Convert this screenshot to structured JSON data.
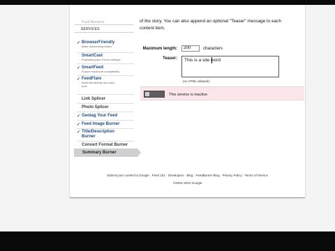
{
  "intro": {
    "line1": "of the story. You can also append an optional \"Teaser\" message to each",
    "line2": "content item."
  },
  "sidebar": {
    "faded_heading": "Feed Burners",
    "services_heading": "SERVICES",
    "items": [
      {
        "checked": true,
        "name": "BrowserFriendly",
        "desc": "Make subscribing easier"
      },
      {
        "checked": false,
        "name": "SmartCast",
        "desc": "Podcasting and iTunes settings"
      },
      {
        "checked": true,
        "name": "SmartFeed",
        "desc": "Ensure maximum compatibility"
      },
      {
        "checked": true,
        "name": "FeedFlare",
        "desc1": "Build interactivity into each",
        "desc2": "post"
      },
      {
        "checked": false,
        "name": "Link Splicer"
      },
      {
        "checked": false,
        "name": "Photo Splicer"
      },
      {
        "checked": true,
        "name": "Geotag Your Feed"
      },
      {
        "checked": true,
        "name": "Feed Image Burner"
      },
      {
        "checked": true,
        "name": "Title/Description",
        "name2": "Burner"
      },
      {
        "checked": false,
        "name": "Convert Format Burner"
      },
      {
        "checked": false,
        "name": "Summary Burner",
        "selected": true
      }
    ]
  },
  "form": {
    "max_length_label": "Maximum length:",
    "max_length_value": "200",
    "max_length_unit": "characters",
    "teaser_label": "Teaser:",
    "teaser_value": "This is a site word",
    "no_html_note": "(no HTML allowed)"
  },
  "status": {
    "text": "This service is inactive",
    "active": false
  },
  "footer": {
    "links": [
      "Submit your content to Google",
      "Feed 101",
      "Developers",
      "Blog",
      "FeedBurner Blog",
      "Privacy Policy",
      "Terms of Service"
    ],
    "separator": " · ",
    "copyright": "©2004–2010 Google"
  },
  "colors": {
    "link": "#1f4b7f",
    "status_bg": "#fbe6e9",
    "selected_bg": "#cfd0d2"
  }
}
